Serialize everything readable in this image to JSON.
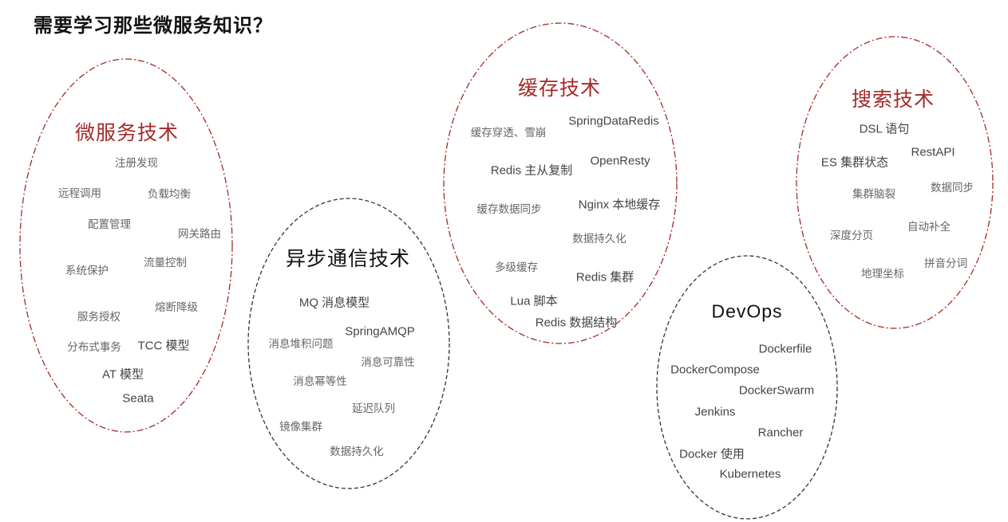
{
  "title": "需要学习那些微服务知识？",
  "colors": {
    "red": "#a52a2a",
    "dark": "#333333"
  },
  "groups": {
    "microservice": {
      "heading": "微服务技术",
      "items": [
        "注册发现",
        "远程调用",
        "负载均衡",
        "配置管理",
        "网关路由",
        "系统保护",
        "流量控制",
        "服务授权",
        "熔断降级",
        "分布式事务",
        "TCC 模型",
        "AT 模型",
        "Seata"
      ]
    },
    "async": {
      "heading": "异步通信技术",
      "items": [
        "MQ 消息模型",
        "SpringAMQP",
        "消息堆积问题",
        "消息可靠性",
        "消息幂等性",
        "延迟队列",
        "镜像集群",
        "数据持久化"
      ]
    },
    "cache": {
      "heading": "缓存技术",
      "items": [
        "SpringDataRedis",
        "缓存穿透、雪崩",
        "OpenResty",
        "Redis 主从复制",
        "Nginx 本地缓存",
        "缓存数据同步",
        "数据持久化",
        "多级缓存",
        "Redis 集群",
        "Lua 脚本",
        "Redis 数据结构"
      ]
    },
    "search": {
      "heading": "搜索技术",
      "items": [
        "DSL 语句",
        "RestAPI",
        "ES 集群状态",
        "集群脑裂",
        "数据同步",
        "深度分页",
        "自动补全",
        "拼音分词",
        "地理坐标"
      ]
    },
    "devops": {
      "heading": "DevOps",
      "items": [
        "Dockerfile",
        "DockerCompose",
        "DockerSwarm",
        "Jenkins",
        "Rancher",
        "Docker 使用",
        "Kubernetes"
      ]
    }
  }
}
